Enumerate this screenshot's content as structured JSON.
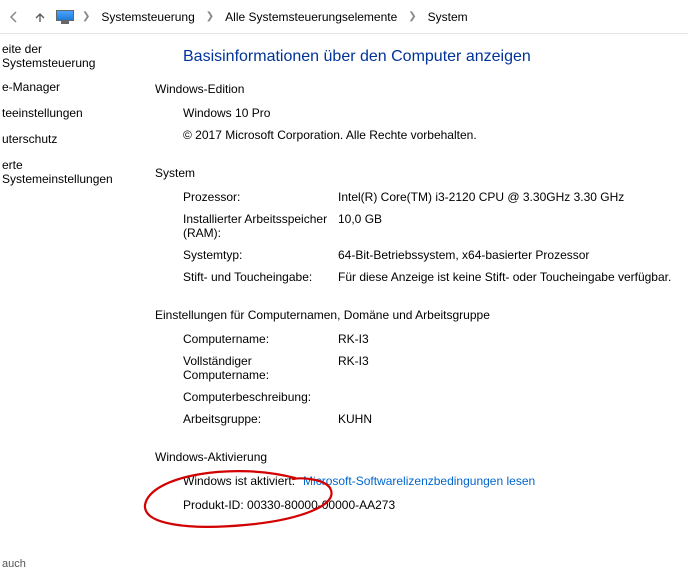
{
  "breadcrumb": {
    "items": [
      {
        "label": "Systemsteuerung"
      },
      {
        "label": "Alle Systemsteuerungselemente"
      },
      {
        "label": "System"
      }
    ]
  },
  "sidebar": {
    "title": "eite der Systemsteuerung",
    "links": [
      "e-Manager",
      "teeinstellungen",
      "uterschutz",
      "erte Systemeinstellungen"
    ],
    "footer": "auch"
  },
  "main": {
    "title": "Basisinformationen über den Computer anzeigen",
    "edition": {
      "heading": "Windows-Edition",
      "product": "Windows 10 Pro",
      "copyright": "© 2017 Microsoft Corporation. Alle Rechte vorbehalten."
    },
    "system": {
      "heading": "System",
      "processor_label": "Prozessor:",
      "processor_value": "Intel(R) Core(TM) i3-2120 CPU @ 3.30GHz   3.30 GHz",
      "ram_label": "Installierter Arbeitsspeicher (RAM):",
      "ram_value": "10,0 GB",
      "type_label": "Systemtyp:",
      "type_value": "64-Bit-Betriebssystem, x64-basierter Prozessor",
      "touch_label": "Stift- und Toucheingabe:",
      "touch_value": "Für diese Anzeige ist keine Stift- oder Toucheingabe verfügbar."
    },
    "names": {
      "heading": "Einstellungen für Computernamen, Domäne und Arbeitsgruppe",
      "comp_label": "Computername:",
      "comp_value": "RK-I3",
      "full_label": "Vollständiger Computername:",
      "full_value": "RK-I3",
      "desc_label": "Computerbeschreibung:",
      "desc_value": "",
      "workgroup_label": "Arbeitsgruppe:",
      "workgroup_value": "KUHN"
    },
    "activation": {
      "heading": "Windows-Aktivierung",
      "status": "Windows ist aktiviert.",
      "link": "Microsoft-Softwarelizenzbedingungen lesen",
      "pid_label": "Produkt-ID:",
      "pid_value": "00330-80000-00000-AA273"
    }
  }
}
